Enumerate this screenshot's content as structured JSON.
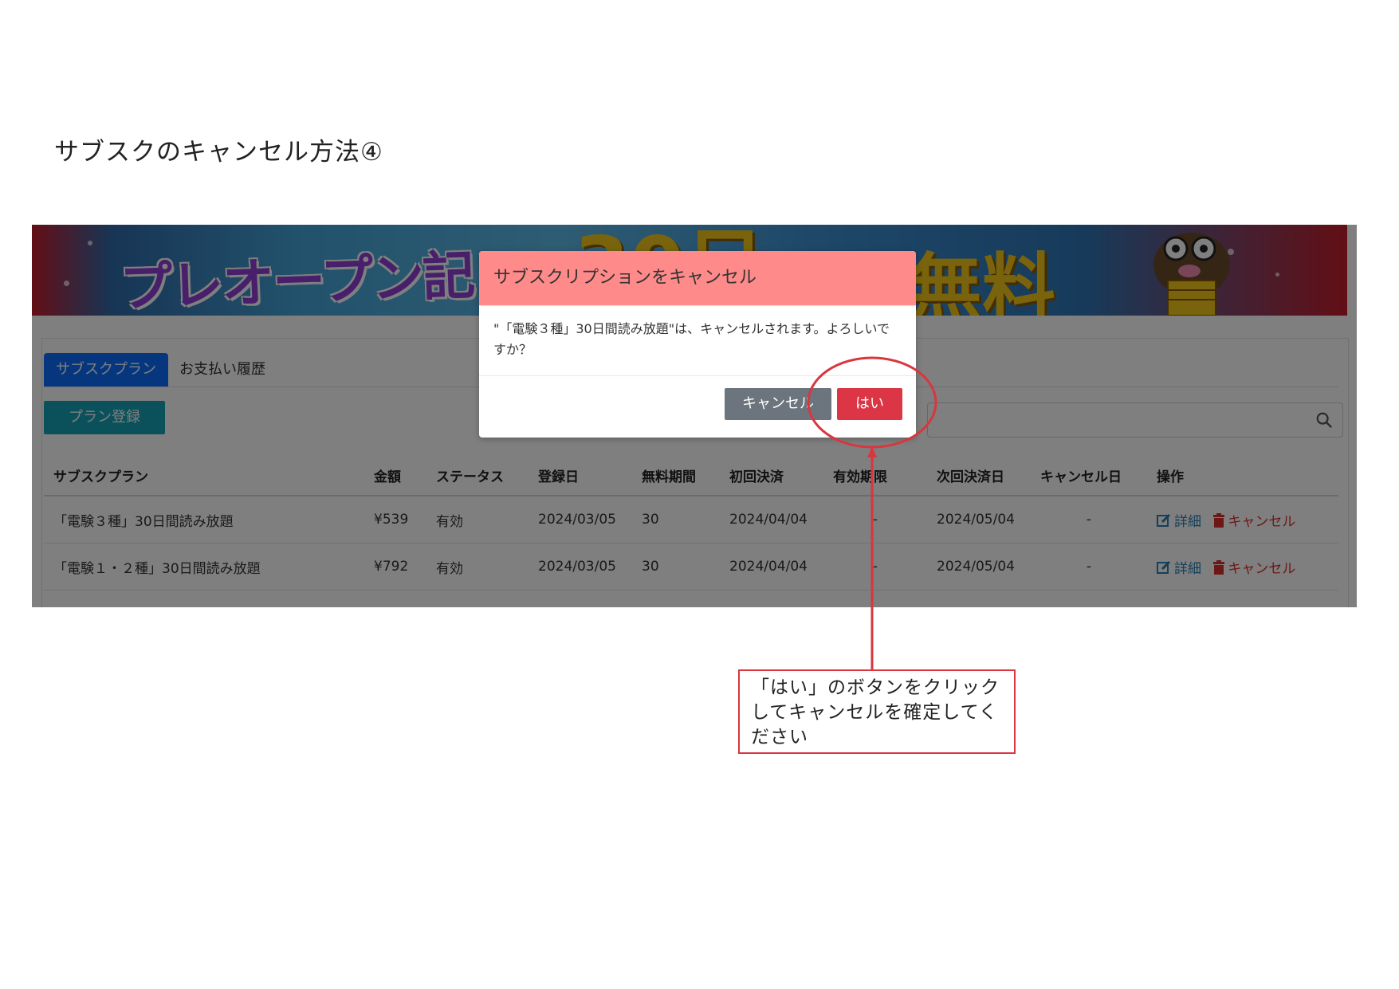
{
  "doc": {
    "title": "サブスクのキャンセル方法④"
  },
  "banner": {
    "text_left": "プレオープン記",
    "text_mid": "30日",
    "text_right": "無料"
  },
  "tabs": {
    "active": "サブスクプラン",
    "inactive": "お支払い履歴"
  },
  "toolbar": {
    "register_label": "プラン登録"
  },
  "table": {
    "headers": [
      "サブスクプラン",
      "金額",
      "ステータス",
      "登録日",
      "無料期間",
      "初回決済",
      "有効期限",
      "次回決済日",
      "キャンセル日",
      "操作"
    ],
    "rows": [
      {
        "plan": "「電験３種」30日間読み放題",
        "price": "¥539",
        "status": "有効",
        "registered": "2024/03/05",
        "free_period": "30",
        "first_payment": "2024/04/04",
        "expiry": "-",
        "next_payment": "2024/05/04",
        "cancel_date": "-",
        "detail_label": "詳細",
        "cancel_label": "キャンセル"
      },
      {
        "plan": "「電験１・２種」30日間読み放題",
        "price": "¥792",
        "status": "有効",
        "registered": "2024/03/05",
        "free_period": "30",
        "first_payment": "2024/04/04",
        "expiry": "-",
        "next_payment": "2024/05/04",
        "cancel_date": "-",
        "detail_label": "詳細",
        "cancel_label": "キャンセル"
      }
    ]
  },
  "modal": {
    "title": "サブスクリプションをキャンセル",
    "message": "\"「電験３種」30日間読み放題\"は、キャンセルされます。よろしいですか？",
    "cancel_label": "キャンセル",
    "confirm_label": "はい"
  },
  "callout": {
    "text": "「はい」のボタンをクリックしてキャンセルを確定してください"
  },
  "colors": {
    "modal_header": "#ff8a8a",
    "confirm_button": "#dc3545",
    "cancel_button": "#6c757d",
    "tab_active": "#0d6efd",
    "register_button": "#17a2b8",
    "annotation": "#d9363e"
  }
}
